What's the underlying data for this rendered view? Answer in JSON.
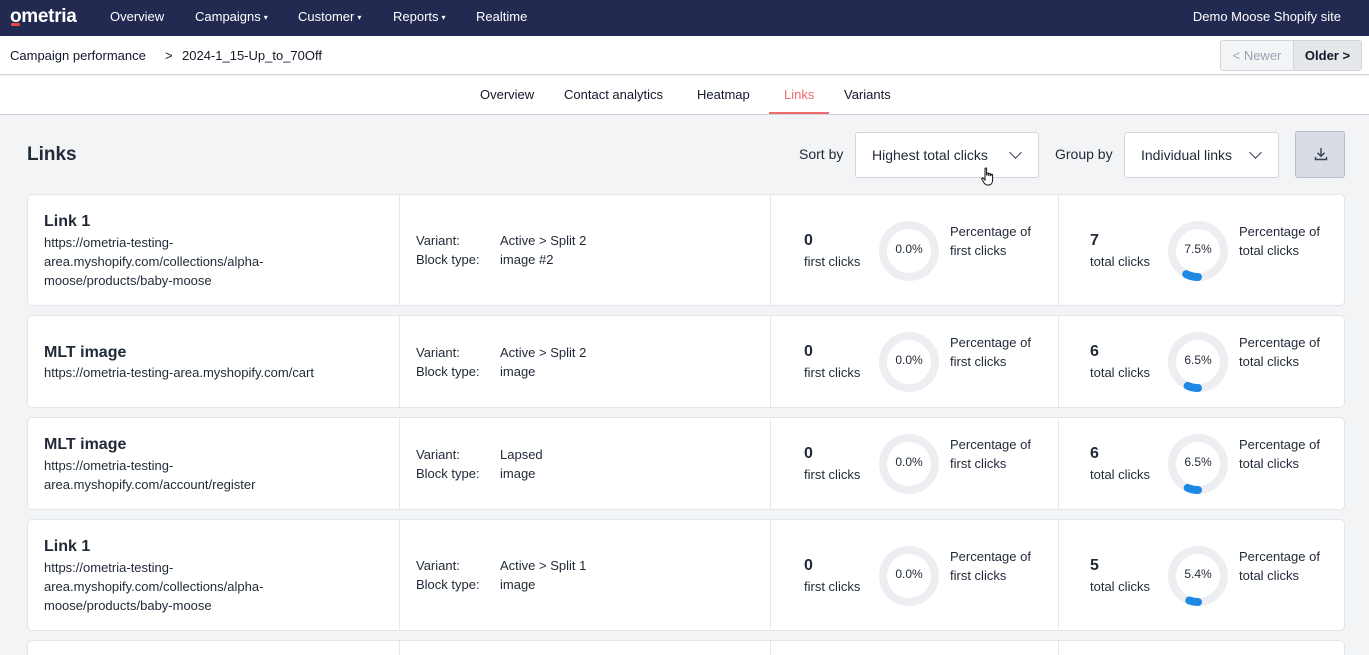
{
  "nav": {
    "logo": "ometria",
    "items": [
      {
        "label": "Overview",
        "caret": ""
      },
      {
        "label": "Campaigns",
        "caret": "▾"
      },
      {
        "label": "Customer",
        "caret": "▾"
      },
      {
        "label": "Reports",
        "caret": "▾"
      },
      {
        "label": "Realtime",
        "caret": ""
      }
    ],
    "site": "Demo Moose Shopify site"
  },
  "breadcrumb": {
    "parent": "Campaign performance",
    "separator": ">",
    "current": "2024-1_15-Up_to_70Off",
    "newer": "< Newer",
    "older": "Older >"
  },
  "tabs": [
    "Overview",
    "Contact analytics",
    "Heatmap",
    "Links",
    "Variants"
  ],
  "active_tab": "Links",
  "toolbar": {
    "title": "Links",
    "sort_label": "Sort by",
    "sort_value": "Highest total clicks",
    "group_label": "Group by",
    "group_value": "Individual links",
    "download_icon": "download-icon"
  },
  "labels": {
    "variant": "Variant:",
    "block_type": "Block type:",
    "first_clicks": "first clicks",
    "total_clicks": "total clicks",
    "pct_first": "Percentage of first clicks",
    "pct_total": "Percentage of total clicks"
  },
  "colors": {
    "accent": "#ef6a6a",
    "nav_bg": "#232a52",
    "donut_fill": "#1e88e5",
    "donut_track": "#eceef2"
  },
  "links": [
    {
      "name": "Link 1",
      "url": "https://ometria-testing-area.myshopify.com/collections/alpha-moose/products/baby-moose",
      "variant": "Active > Split 2",
      "block_type": "image #2",
      "first_clicks": "0",
      "first_pct": "0.0%",
      "first_fraction": 0.0,
      "total_clicks": "7",
      "total_pct": "7.5%",
      "total_fraction": 0.075
    },
    {
      "name": "MLT image",
      "url": "https://ometria-testing-area.myshopify.com/cart",
      "variant": "Active > Split 2",
      "block_type": "image",
      "first_clicks": "0",
      "first_pct": "0.0%",
      "first_fraction": 0.0,
      "total_clicks": "6",
      "total_pct": "6.5%",
      "total_fraction": 0.065
    },
    {
      "name": "MLT image",
      "url": "https://ometria-testing-area.myshopify.com/account/register",
      "variant": "Lapsed",
      "block_type": "image",
      "first_clicks": "0",
      "first_pct": "0.0%",
      "first_fraction": 0.0,
      "total_clicks": "6",
      "total_pct": "6.5%",
      "total_fraction": 0.065
    },
    {
      "name": "Link 1",
      "url": "https://ometria-testing-area.myshopify.com/collections/alpha-moose/products/baby-moose",
      "variant": "Active > Split 1",
      "block_type": "image",
      "first_clicks": "0",
      "first_pct": "0.0%",
      "first_fraction": 0.0,
      "total_clicks": "5",
      "total_pct": "5.4%",
      "total_fraction": 0.054
    }
  ]
}
